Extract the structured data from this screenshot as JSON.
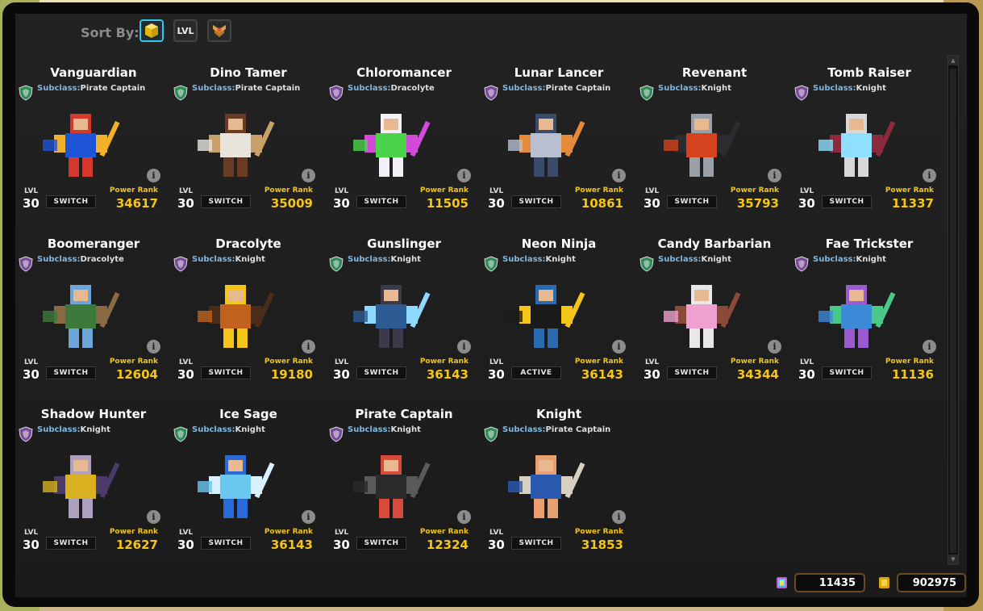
{
  "sort": {
    "label": "Sort By:",
    "buttons": [
      {
        "name": "power",
        "icon": "cube-icon",
        "active": true
      },
      {
        "name": "level",
        "label": "LVL",
        "active": false
      },
      {
        "name": "rank",
        "icon": "rank-badge-icon",
        "active": false
      }
    ]
  },
  "card_labels": {
    "subclass_key": "Subclass:",
    "lvl": "LVL",
    "power_rank": "Power Rank",
    "info": "i"
  },
  "classes": [
    {
      "name": "Vanguardian",
      "subclass": "Pirate Captain",
      "level": "30",
      "button": "SWITCH",
      "power_rank": "34617",
      "shield_color": "#2e8b57",
      "palette": [
        "#1e54d6",
        "#f1b12a",
        "#d4372c"
      ]
    },
    {
      "name": "Dino Tamer",
      "subclass": "Pirate Captain",
      "level": "30",
      "button": "SWITCH",
      "power_rank": "35009",
      "shield_color": "#2e8b57",
      "palette": [
        "#e8e4dc",
        "#c9a06a",
        "#6a3a22"
      ]
    },
    {
      "name": "Chloromancer",
      "subclass": "Dracolyte",
      "level": "30",
      "button": "SWITCH",
      "power_rank": "11505",
      "shield_color": "#7a4a9a",
      "palette": [
        "#4bd44a",
        "#d34ad8",
        "#f4f0f8"
      ]
    },
    {
      "name": "Lunar Lancer",
      "subclass": "Pirate Captain",
      "level": "30",
      "button": "SWITCH",
      "power_rank": "10861",
      "shield_color": "#7a4a9a",
      "palette": [
        "#b7bfd0",
        "#e58a3a",
        "#3a4a6a"
      ]
    },
    {
      "name": "Revenant",
      "subclass": "Knight",
      "level": "30",
      "button": "SWITCH",
      "power_rank": "35793",
      "shield_color": "#2e8b57",
      "palette": [
        "#d4431e",
        "#2c2c30",
        "#9aa0a8"
      ]
    },
    {
      "name": "Tomb Raiser",
      "subclass": "Knight",
      "level": "30",
      "button": "SWITCH",
      "power_rank": "11337",
      "shield_color": "#7a4a9a",
      "palette": [
        "#8fe0ff",
        "#8a2a3a",
        "#d8d8d8"
      ]
    },
    {
      "name": "Boomeranger",
      "subclass": "Dracolyte",
      "level": "30",
      "button": "SWITCH",
      "power_rank": "12604",
      "shield_color": "#7a4a9a",
      "palette": [
        "#3b7a3a",
        "#8a6a44",
        "#6da5d8"
      ]
    },
    {
      "name": "Dracolyte",
      "subclass": "Knight",
      "level": "30",
      "button": "SWITCH",
      "power_rank": "19180",
      "shield_color": "#7a4a9a",
      "palette": [
        "#c0621d",
        "#4a2c1a",
        "#f5c518"
      ]
    },
    {
      "name": "Gunslinger",
      "subclass": "Knight",
      "level": "30",
      "button": "SWITCH",
      "power_rank": "36143",
      "shield_color": "#2e8b57",
      "palette": [
        "#2d5b93",
        "#8fd8ff",
        "#3a3a4a"
      ]
    },
    {
      "name": "Neon Ninja",
      "subclass": "Knight",
      "level": "30",
      "button": "ACTIVE",
      "power_rank": "36143",
      "shield_color": "#2e8b57",
      "palette": [
        "#1a1a1a",
        "#f5c518",
        "#2a6ab0"
      ]
    },
    {
      "name": "Candy Barbarian",
      "subclass": "Knight",
      "level": "30",
      "button": "SWITCH",
      "power_rank": "34344",
      "shield_color": "#2e8b57",
      "palette": [
        "#f0a0d0",
        "#8a4a3a",
        "#e8e8e8"
      ]
    },
    {
      "name": "Fae Trickster",
      "subclass": "Knight",
      "level": "30",
      "button": "SWITCH",
      "power_rank": "11136",
      "shield_color": "#7a4a9a",
      "palette": [
        "#3a8ad8",
        "#4ac88a",
        "#9a5ad0"
      ]
    },
    {
      "name": "Shadow Hunter",
      "subclass": "Knight",
      "level": "30",
      "button": "SWITCH",
      "power_rank": "12627",
      "shield_color": "#7a4a9a",
      "palette": [
        "#d8b020",
        "#4a3a6a",
        "#b0a0c0"
      ]
    },
    {
      "name": "Ice Sage",
      "subclass": "Knight",
      "level": "30",
      "button": "SWITCH",
      "power_rank": "36143",
      "shield_color": "#2e8b57",
      "palette": [
        "#6ac8f0",
        "#d8f0ff",
        "#2a6ad8"
      ]
    },
    {
      "name": "Pirate Captain",
      "subclass": "Knight",
      "level": "30",
      "button": "SWITCH",
      "power_rank": "12324",
      "shield_color": "#7a4a9a",
      "palette": [
        "#2a2a2a",
        "#5a5a5a",
        "#d84a3a"
      ]
    },
    {
      "name": "Knight",
      "subclass": "Pirate Captain",
      "level": "30",
      "button": "SWITCH",
      "power_rank": "31853",
      "shield_color": "#2e8b57",
      "palette": [
        "#2a5ab0",
        "#d8d0c0",
        "#e8a070"
      ]
    }
  ],
  "currency": {
    "cubits": "11435",
    "gold": "902975"
  },
  "colors": {
    "power_rank": "#f5c518",
    "active_sort": "#37c7e8",
    "panel": "#1f1f1f"
  }
}
